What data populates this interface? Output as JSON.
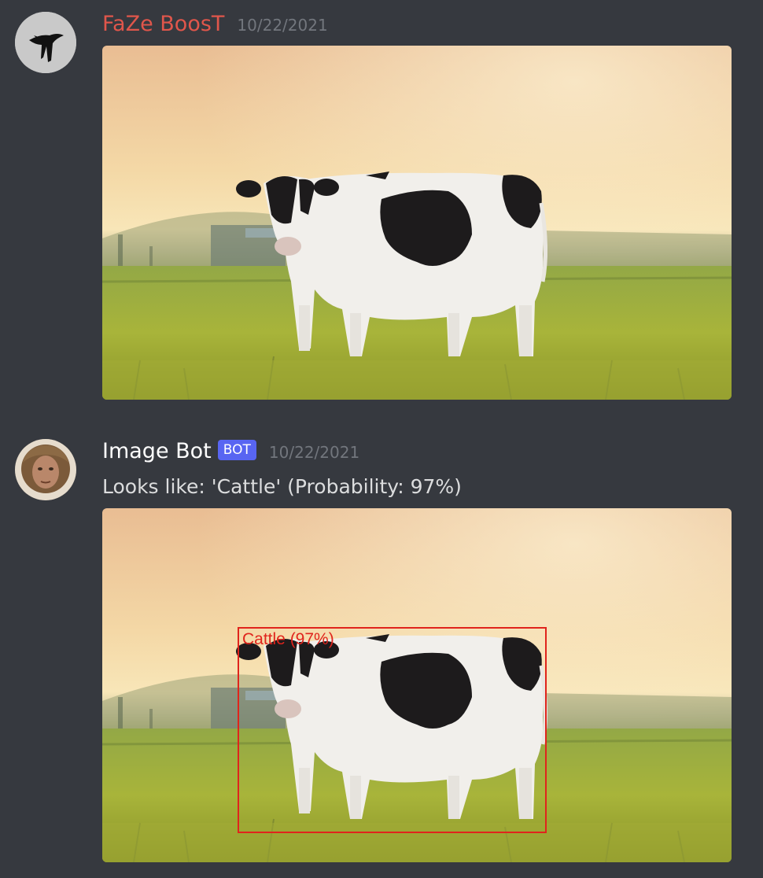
{
  "colors": {
    "background": "#36393f",
    "faze_username": "#e0564b",
    "bot_username": "#ffffff",
    "bot_tag": "#5865f2",
    "timestamp": "#72767d",
    "message_text": "#dcddde",
    "detection_box": "#e0241c"
  },
  "messages": [
    {
      "author": "FaZe BoosT",
      "timestamp": "10/22/2021",
      "avatar_icon": "black-bird-on-gray-avatar",
      "attachment": "cow-photo"
    },
    {
      "author": "Image Bot",
      "bot_tag": "BOT",
      "timestamp": "10/22/2021",
      "avatar_icon": "curly-haired-man-avatar",
      "text": "Looks like: 'Cattle' (Probability: 97%)",
      "attachment": "cow-photo-annotated",
      "detection_label": "Cattle (97%)"
    }
  ]
}
